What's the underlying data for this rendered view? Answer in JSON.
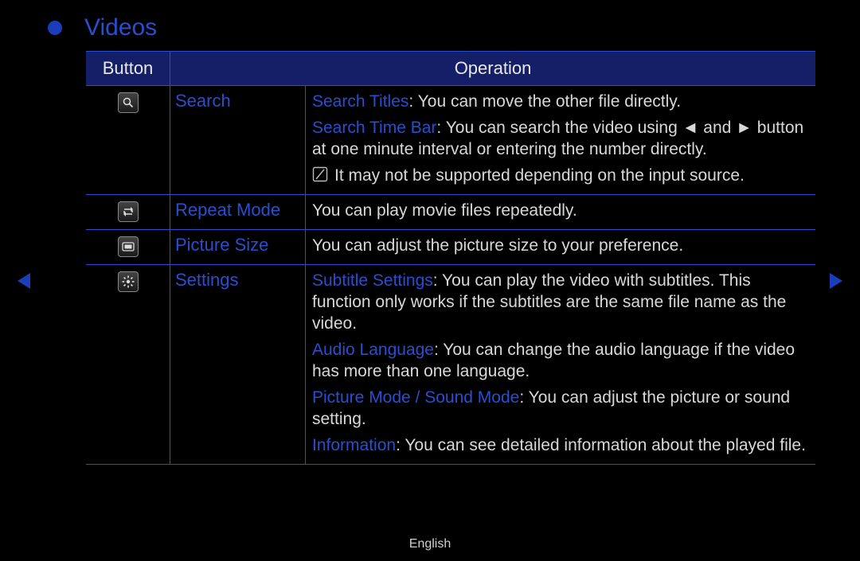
{
  "title": "Videos",
  "header": {
    "button": "Button",
    "operation": "Operation"
  },
  "rows": {
    "search": {
      "name": "Search",
      "titles_term": "Search Titles",
      "titles_text": ": You can move the other file directly.",
      "timebar_term": "Search Time Bar",
      "timebar_text_a": ": You can search the video using ",
      "timebar_text_b": " and ",
      "timebar_text_c": " button at one minute interval or entering the number directly.",
      "note": "It may not be supported depending on the input source."
    },
    "repeat": {
      "name": "Repeat Mode",
      "text": "You can play movie files repeatedly."
    },
    "psize": {
      "name": "Picture Size",
      "text": "You can adjust the picture size to your preference."
    },
    "settings": {
      "name": "Settings",
      "sub_term": "Subtitle Settings",
      "sub_text": ": You can play the video with subtitles. This function only works if the subtitles are the same file name as the video.",
      "aud_term": "Audio Language",
      "aud_text": ": You can change the audio language if the video has more than one language.",
      "mode_term": "Picture Mode / Sound Mode",
      "mode_text": ": You can adjust the picture or sound setting.",
      "info_term": "Information",
      "info_text": ": You can see detailed information about the played file."
    }
  },
  "footer": "English"
}
